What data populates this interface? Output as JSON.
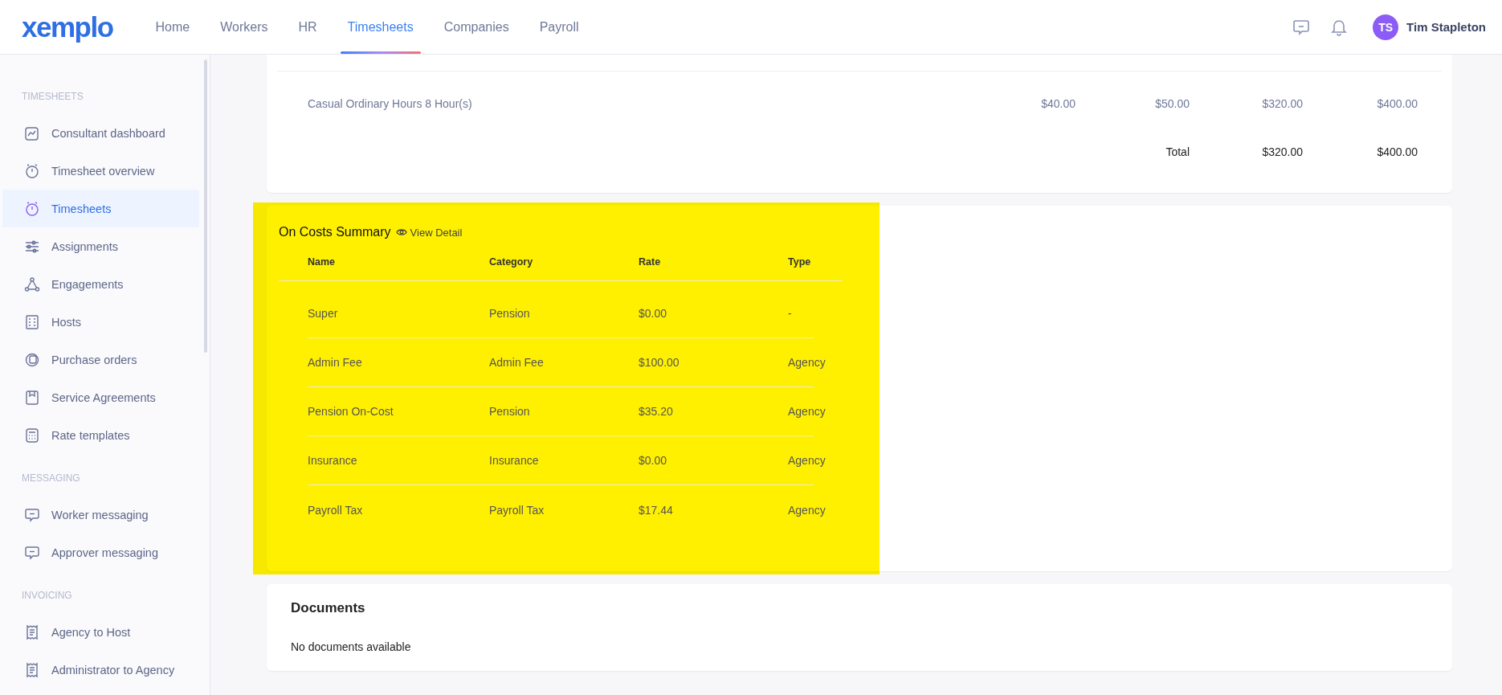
{
  "brand": {
    "logo": "xemplo"
  },
  "nav": [
    {
      "label": "Home",
      "selected": false
    },
    {
      "label": "Workers",
      "selected": false
    },
    {
      "label": "HR",
      "selected": false
    },
    {
      "label": "Timesheets",
      "selected": true
    },
    {
      "label": "Companies",
      "selected": false
    },
    {
      "label": "Payroll",
      "selected": false
    }
  ],
  "user": {
    "initials": "TS",
    "name": "Tim Stapleton"
  },
  "sidebar": {
    "sections": [
      {
        "heading": "TIMESHEETS",
        "items": [
          {
            "label": "Consultant dashboard",
            "selected": false
          },
          {
            "label": "Timesheet overview",
            "selected": false
          },
          {
            "label": "Timesheets",
            "selected": true
          },
          {
            "label": "Assignments",
            "selected": false
          },
          {
            "label": "Engagements",
            "selected": false
          },
          {
            "label": "Hosts",
            "selected": false
          },
          {
            "label": "Purchase orders",
            "selected": false
          },
          {
            "label": "Service Agreements",
            "selected": false
          },
          {
            "label": "Rate templates",
            "selected": false
          }
        ]
      },
      {
        "heading": "MESSAGING",
        "items": [
          {
            "label": "Worker messaging",
            "selected": false
          },
          {
            "label": "Approver messaging",
            "selected": false
          }
        ]
      },
      {
        "heading": "INVOICING",
        "items": [
          {
            "label": "Agency to Host",
            "selected": false
          },
          {
            "label": "Administrator to Agency",
            "selected": false
          }
        ]
      }
    ]
  },
  "rates_table": {
    "rows": [
      {
        "description": "Casual Ordinary Hours 8 Hour(s)",
        "values": [
          "$40.00",
          "$50.00",
          "$320.00",
          "$400.00"
        ]
      }
    ],
    "total": {
      "label": "Total",
      "values": [
        "$320.00",
        "$400.00"
      ]
    }
  },
  "on_costs": {
    "title": "On Costs Summary",
    "link": "View Detail",
    "highlighted": true,
    "columns": [
      "Name",
      "Category",
      "Rate",
      "Type"
    ],
    "rows": [
      [
        "Super",
        "Pension",
        "$0.00",
        "-"
      ],
      [
        "Admin Fee",
        "Admin Fee",
        "$100.00",
        "Agency"
      ],
      [
        "Pension On-Cost",
        "Pension",
        "$35.20",
        "Agency"
      ],
      [
        "Insurance",
        "Insurance",
        "$0.00",
        "Agency"
      ],
      [
        "Payroll Tax",
        "Payroll Tax",
        "$17.44",
        "Agency"
      ]
    ]
  },
  "documents": {
    "title": "Documents",
    "message": "No documents available"
  }
}
